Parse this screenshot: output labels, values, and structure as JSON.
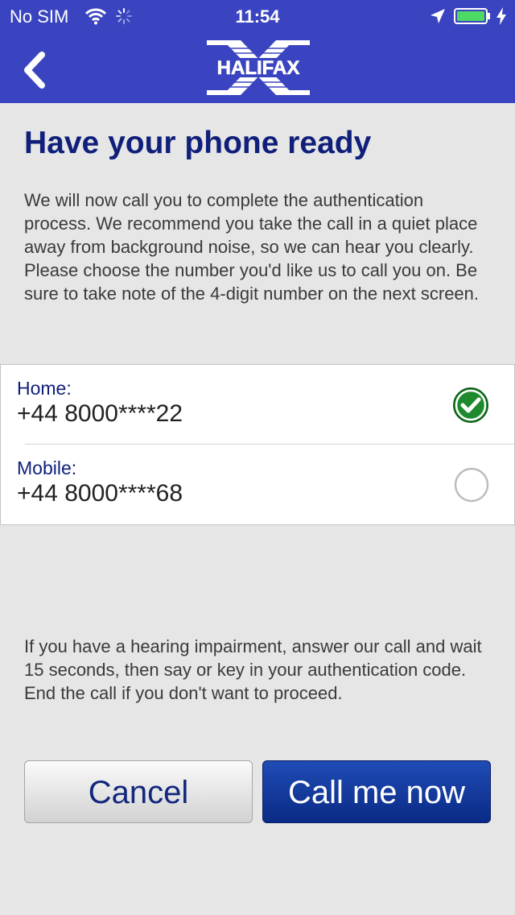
{
  "status_bar": {
    "carrier": "No SIM",
    "time": "11:54"
  },
  "header": {
    "back_icon": "chevron-left-icon",
    "logo_text": "HALIFAX",
    "brand_color": "#3a44c0"
  },
  "title": "Have your phone ready",
  "intro": "We will now call you to complete the authentication process. We recommend you take the call in a quiet place away from background noise, so we can hear you clearly. Please choose the number you'd like us to call you on. Be sure to take note of the 4-digit number on the next screen.",
  "options": [
    {
      "label": "Home:",
      "number": "+44 8000****22",
      "selected": true
    },
    {
      "label": "Mobile:",
      "number": "+44 8000****68",
      "selected": false
    }
  ],
  "hearing_note": "If you have a hearing impairment, answer our call and wait 15 seconds, then say or key in your authentication code. End the call if you don't want to proceed.",
  "buttons": {
    "cancel": "Cancel",
    "call": "Call me now"
  },
  "colors": {
    "heading": "#0f1f7a",
    "selected_check": "#1e8a2e",
    "primary_button": "#0a2a86"
  }
}
